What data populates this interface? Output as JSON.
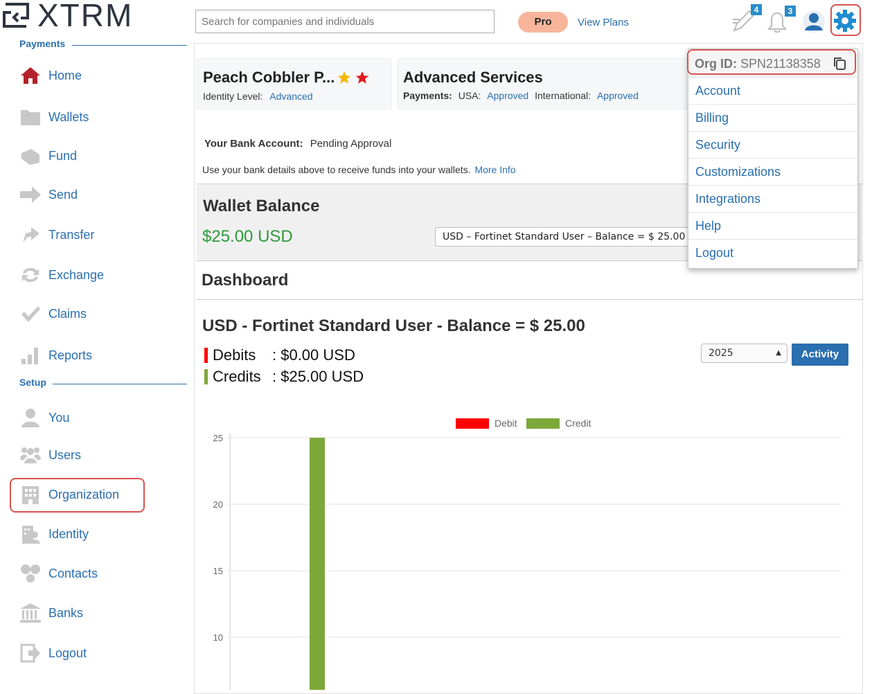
{
  "brand": {
    "logo_text": "XTRM"
  },
  "search": {
    "placeholder": "Search for companies and individuals"
  },
  "topbar": {
    "pro_label": "Pro",
    "view_plans_label": "View Plans",
    "tasks_count": "4",
    "notifications_count": "3"
  },
  "sidebar": {
    "payments_label": "Payments",
    "setup_label": "Setup",
    "payments_items": [
      {
        "label": "Home",
        "icon": "home-icon"
      },
      {
        "label": "Wallets",
        "icon": "folder-icon"
      },
      {
        "label": "Fund",
        "icon": "fund-icon"
      },
      {
        "label": "Send",
        "icon": "send-arrow-icon"
      },
      {
        "label": "Transfer",
        "icon": "transfer-icon"
      },
      {
        "label": "Exchange",
        "icon": "exchange-icon"
      },
      {
        "label": "Claims",
        "icon": "check-icon"
      },
      {
        "label": "Reports",
        "icon": "bar-chart-icon"
      }
    ],
    "setup_items": [
      {
        "label": "You",
        "icon": "person-icon"
      },
      {
        "label": "Users",
        "icon": "users-icon"
      },
      {
        "label": "Organization",
        "icon": "building-icon"
      },
      {
        "label": "Identity",
        "icon": "identity-icon"
      },
      {
        "label": "Contacts",
        "icon": "contacts-icon"
      },
      {
        "label": "Banks",
        "icon": "bank-icon"
      },
      {
        "label": "Logout",
        "icon": "logout-icon"
      }
    ]
  },
  "profile_card": {
    "name": "Peach Cobbler P...",
    "identity_label": "Identity Level:",
    "identity_value": "Advanced"
  },
  "services_card": {
    "title": "Advanced Services",
    "payments_label": "Payments:",
    "usa_label": "USA:",
    "usa_value": "Approved",
    "intl_label": "International:",
    "intl_value": "Approved"
  },
  "bank": {
    "label": "Your Bank Account:",
    "status": "Pending Approval",
    "info_text": "Use your bank details above to receive funds into your wallets.",
    "more_info": "More Info"
  },
  "wallet": {
    "title": "Wallet Balance",
    "amount": "$25.00 USD",
    "selected": "USD – Fortinet Standard User – Balance = $ 25.00"
  },
  "dashboard": {
    "title": "Dashboard",
    "wallet_heading": "USD - Fortinet Standard User - Balance = $ 25.00",
    "debits_label": "Debits",
    "debits_value": ": $0.00 USD",
    "credits_label": "Credits",
    "credits_value": ": $25.00 USD",
    "year": "2025",
    "activity_label": "Activity"
  },
  "dropdown": {
    "org_label": "Org ID:",
    "org_id": "SPN21138358",
    "items": [
      "Account",
      "Billing",
      "Security",
      "Customizations",
      "Integrations",
      "Help",
      "Logout"
    ]
  },
  "colors": {
    "accent": "#2a6fb0",
    "debit": "#ff0000",
    "credit": "#7ea73a",
    "wallet_amount": "#2e9a3a",
    "highlight": "#d9534f"
  },
  "chart_data": {
    "type": "bar",
    "series": [
      {
        "name": "Debit",
        "values": [
          0
        ]
      },
      {
        "name": "Credit",
        "values": [
          25
        ]
      }
    ],
    "categories": [
      ""
    ],
    "y_ticks": [
      25,
      20,
      15,
      10
    ],
    "ylim": [
      10,
      25
    ],
    "legend": "top",
    "grid": true
  }
}
